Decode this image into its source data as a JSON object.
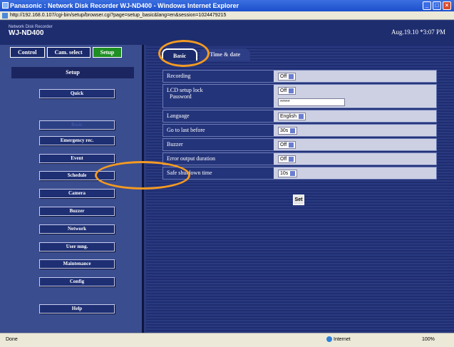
{
  "window": {
    "title": "Panasonic : Network Disk Recorder WJ-ND400 - Windows Internet Explorer",
    "address": "http://192.168.0.107/cgi-bin/setup/browser.cgi?page=setup_basic&lang=en&session=1024479215"
  },
  "header": {
    "brand_sub": "Network Disk Recorder",
    "brand_main": "WJ-ND400",
    "clock": "Aug.19.10 *3:07 PM"
  },
  "modes": [
    {
      "label": "Control"
    },
    {
      "label": "Cam. select"
    },
    {
      "label": "Setup"
    }
  ],
  "sidebar": {
    "heading": "Setup",
    "items": [
      {
        "label": "Quick"
      },
      {
        "label": "Basic"
      },
      {
        "label": "Emergency rec."
      },
      {
        "label": "Event"
      },
      {
        "label": "Schedule"
      },
      {
        "label": "Camera"
      },
      {
        "label": "Buzzer"
      },
      {
        "label": "Network"
      },
      {
        "label": "User mng."
      },
      {
        "label": "Maintenance"
      },
      {
        "label": "Config"
      },
      {
        "label": "Help"
      }
    ]
  },
  "tabs": [
    {
      "label": "Basic"
    },
    {
      "label": "Time & date"
    }
  ],
  "settings": {
    "recording": {
      "label": "Recording",
      "value": "Off"
    },
    "lcd_lock": {
      "label": "LCD setup lock",
      "value": "Off"
    },
    "password": {
      "label": "Password",
      "value": "*****"
    },
    "language": {
      "label": "Language",
      "value": "English"
    },
    "goto_last": {
      "label": "Go to last before",
      "value": "30s"
    },
    "buzzer": {
      "label": "Buzzer",
      "value": "Off"
    },
    "error_output": {
      "label": "Error output duration",
      "value": "Off"
    },
    "safe_shutdown": {
      "label": "Safe shutdown time",
      "value": "10s"
    },
    "set_button": "Set"
  },
  "statusbar": {
    "left": "Done",
    "zone": "Internet",
    "zoom": "100%"
  },
  "colors": {
    "highlight_ring": "#f39a22",
    "active_mode": "#1f8f24",
    "panel_bg": "#1f2d70"
  }
}
